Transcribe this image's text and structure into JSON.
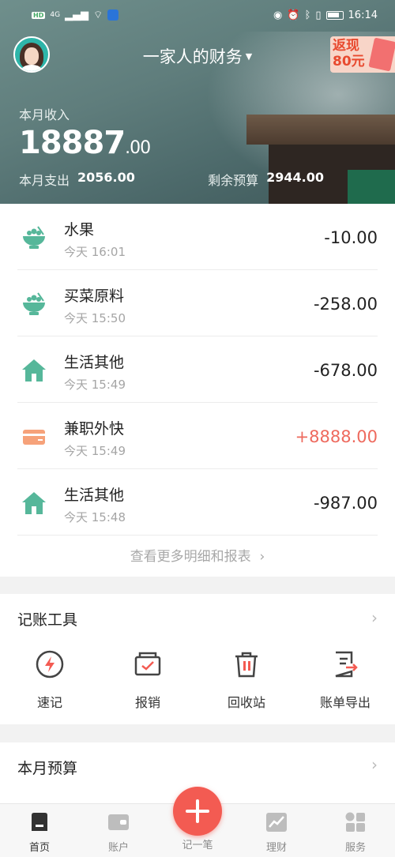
{
  "status_bar": {
    "left_badge": "HD",
    "network": "4G",
    "time": "16:14"
  },
  "header": {
    "book_title": "一家人的财务",
    "promo_text_line1": "返现",
    "promo_text_line2": "80元",
    "income_label": "本月收入",
    "income_int": "18887",
    "income_dec": ".00",
    "expense_label": "本月支出",
    "expense_value": "2056.00",
    "budget_left_label": "剩余预算",
    "budget_left_value": "2944.00"
  },
  "transactions": [
    {
      "name": "水果",
      "time": "今天 16:01",
      "amount": "-10.00",
      "type": "expense",
      "icon": "food-bowl-icon"
    },
    {
      "name": "买菜原料",
      "time": "今天 15:50",
      "amount": "-258.00",
      "type": "expense",
      "icon": "food-bowl-icon"
    },
    {
      "name": "生活其他",
      "time": "今天 15:49",
      "amount": "-678.00",
      "type": "expense",
      "icon": "house-icon"
    },
    {
      "name": "兼职外快",
      "time": "今天 15:49",
      "amount": "+8888.00",
      "type": "income",
      "icon": "wallet-card-icon"
    },
    {
      "name": "生活其他",
      "time": "今天 15:48",
      "amount": "-987.00",
      "type": "expense",
      "icon": "house-icon"
    }
  ],
  "more_link": "查看更多明细和报表",
  "tools": {
    "title": "记账工具",
    "items": [
      {
        "label": "速记",
        "icon": "lightning-icon"
      },
      {
        "label": "报销",
        "icon": "reimburse-icon"
      },
      {
        "label": "回收站",
        "icon": "trash-icon"
      },
      {
        "label": "账单导出",
        "icon": "export-icon"
      }
    ]
  },
  "budget": {
    "title": "本月预算"
  },
  "nav": {
    "items": [
      {
        "label": "首页",
        "icon": "home-icon",
        "active": true
      },
      {
        "label": "账户",
        "icon": "wallet-icon",
        "active": false
      },
      {
        "label": "记一笔",
        "icon": "plus-icon",
        "active": false
      },
      {
        "label": "理财",
        "icon": "chart-icon",
        "active": false
      },
      {
        "label": "服务",
        "icon": "grid-icon",
        "active": false
      }
    ]
  },
  "colors": {
    "expense_icon": "#56b79a",
    "income_icon": "#f6a27a",
    "income_amount": "#ee6a5e",
    "tool_icon": "#444444",
    "tool_accent": "#f35b52",
    "fab": "#f35b52"
  }
}
